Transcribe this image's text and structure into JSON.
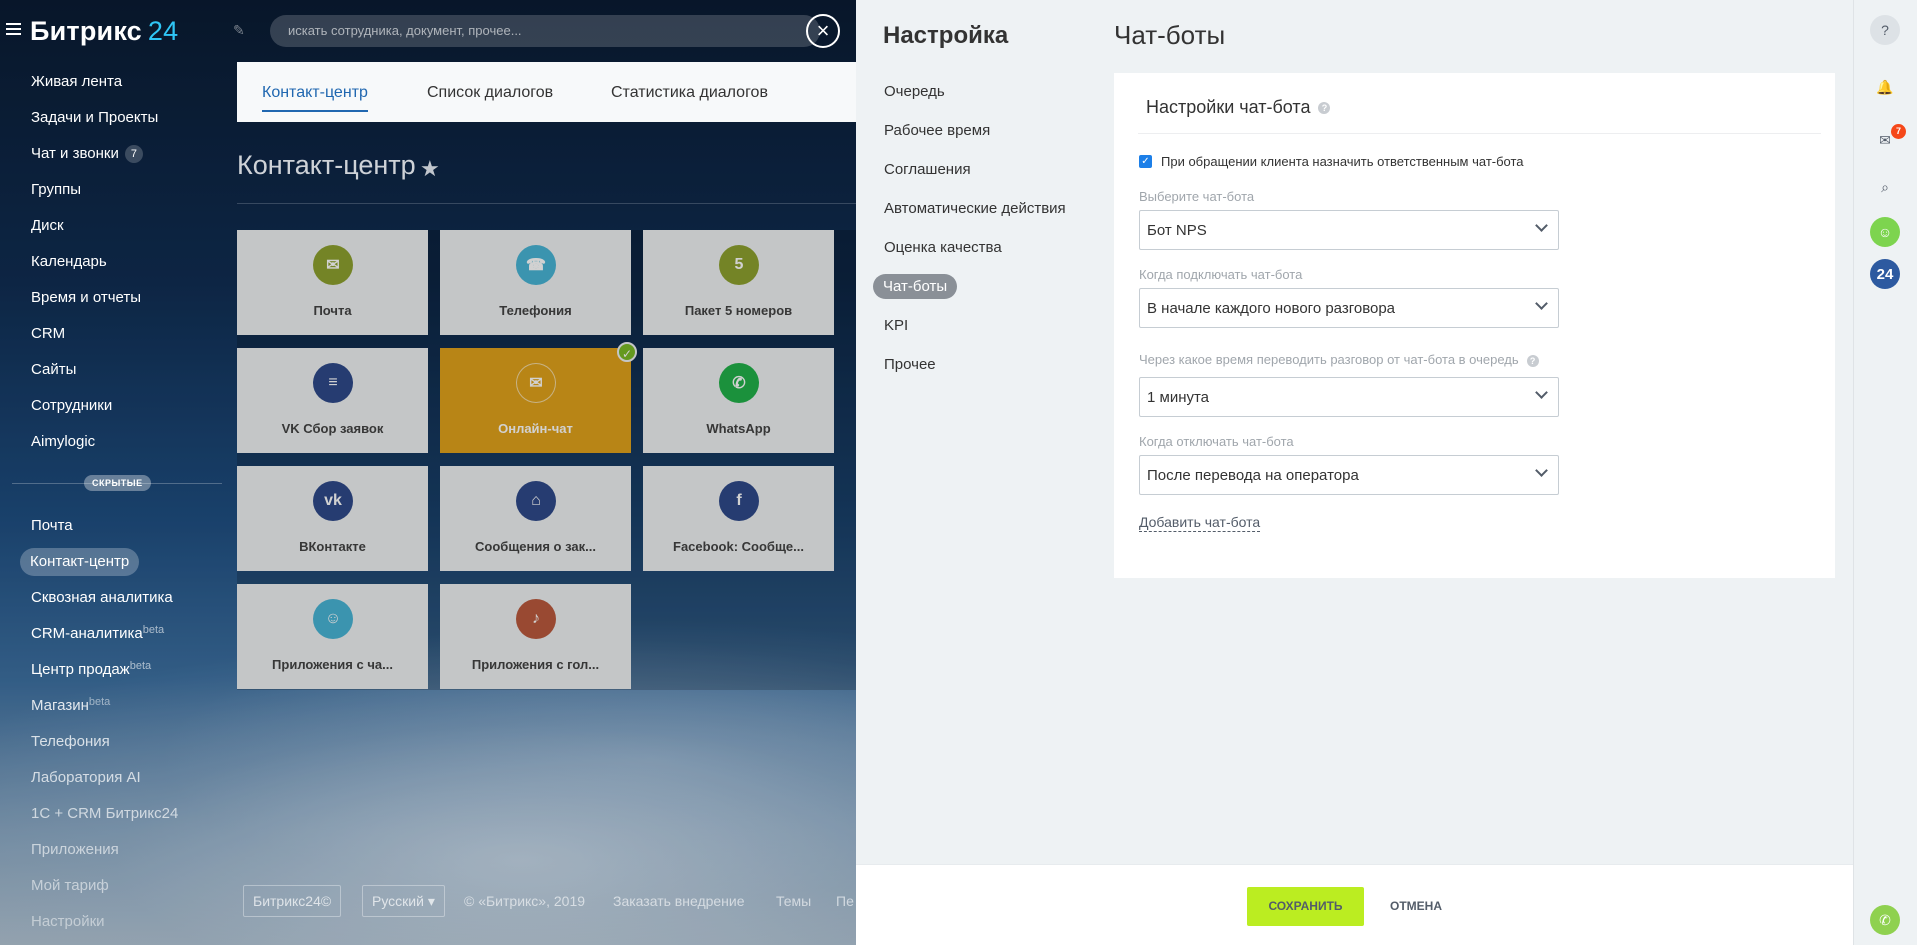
{
  "portal": {
    "logo_text": "Битрикс",
    "logo_num": "24",
    "search_placeholder": "искать сотрудника, документ, прочее..."
  },
  "left_menu": {
    "items": [
      {
        "label": "Живая лента"
      },
      {
        "label": "Задачи и Проекты"
      },
      {
        "label": "Чат и звонки",
        "badge": "7"
      },
      {
        "label": "Группы"
      },
      {
        "label": "Диск"
      },
      {
        "label": "Календарь"
      },
      {
        "label": "Время и отчеты"
      },
      {
        "label": "CRM"
      },
      {
        "label": "Сайты"
      },
      {
        "label": "Сотрудники"
      },
      {
        "label": "Aimylogic"
      }
    ],
    "hidden_label": "СКРЫТЫЕ",
    "hidden_items": [
      {
        "label": "Почта"
      },
      {
        "label": "Контакт-центр"
      },
      {
        "label": "Сквозная аналитика"
      },
      {
        "label": "CRM-аналитика",
        "sup": "beta"
      },
      {
        "label": "Центр продаж",
        "sup": "beta"
      },
      {
        "label": "Магазин",
        "sup": "beta"
      },
      {
        "label": "Телефония"
      },
      {
        "label": "Лаборатория AI"
      },
      {
        "label": "1С + CRM Битрикс24"
      },
      {
        "label": "Приложения"
      },
      {
        "label": "Мой тариф"
      },
      {
        "label": "Настройки"
      }
    ]
  },
  "content": {
    "tabs": [
      "Контакт-центр",
      "Список диалогов",
      "Статистика диалогов"
    ],
    "title": "Контакт-центр",
    "tiles": [
      {
        "label": "Почта",
        "icon": "mail-icon",
        "color": "#8ea22f",
        "glyph": "✉"
      },
      {
        "label": "Телефония",
        "icon": "phone-icon",
        "color": "#49b5d6",
        "glyph": "☎"
      },
      {
        "label": "Пакет 5 номеров",
        "icon": "numbers-pack-icon",
        "color": "#8ea22f",
        "glyph": "5"
      },
      {
        "label": "VK Сбор заявок",
        "icon": "vk-leads-icon",
        "color": "#2f4a8a",
        "glyph": "≡"
      },
      {
        "label": "Онлайн-чат",
        "icon": "chat-icon",
        "color": "#e1a31b",
        "glyph": "✉"
      },
      {
        "label": "WhatsApp",
        "icon": "whatsapp-icon",
        "color": "#21b14a",
        "glyph": "✆"
      },
      {
        "label": "ВКонтакте",
        "icon": "vk-icon",
        "color": "#2f4a8a",
        "glyph": "vk"
      },
      {
        "label": "Сообщения о зак...",
        "icon": "vk-orders-icon",
        "color": "#2f4a8a",
        "glyph": "⌂"
      },
      {
        "label": "Facebook: Сообще...",
        "icon": "facebook-icon",
        "color": "#2f4a8a",
        "glyph": "f"
      },
      {
        "label": "Приложения с ча...",
        "icon": "chat-apps-icon",
        "color": "#49b5d6",
        "glyph": "☺"
      },
      {
        "label": "Приложения с гол...",
        "icon": "voice-apps-icon",
        "color": "#bb5a3d",
        "glyph": "♪"
      }
    ]
  },
  "footer": {
    "brand": "Битрикс24©",
    "language": "Русский",
    "copyright": "© «Битрикс», 2019",
    "order_link": "Заказать внедрение",
    "themes_link": "Темы",
    "print_link": "Пе"
  },
  "settings": {
    "title": "Настройка",
    "nav": [
      "Очередь",
      "Рабочее время",
      "Соглашения",
      "Автоматические действия",
      "Оценка качества",
      "Чат-боты",
      "KPI",
      "Прочее"
    ],
    "active_index": 5,
    "section_title": "Чат-боты",
    "card": {
      "heading": "Настройки чат-бота",
      "checkbox_label": "При обращении клиента назначить ответственным чат-бота",
      "choose_label": "Выберите чат-бота",
      "choose_value": "Бот NPS",
      "when_connect_label": "Когда подключать чат-бота",
      "when_connect_value": "В начале каждого нового разговора",
      "transfer_label": "Через какое время переводить разговор от чат-бота в очередь",
      "transfer_value": "1 минута",
      "when_disable_label": "Когда отключать чат-бота",
      "when_disable_value": "После перевода на оператора",
      "add_link": "Добавить чат-бота"
    },
    "buttons": {
      "save": "СОХРАНИТЬ",
      "cancel": "ОТМЕНА"
    }
  },
  "right_strip": {
    "notifications_badge": "7",
    "b24_label": "24"
  }
}
